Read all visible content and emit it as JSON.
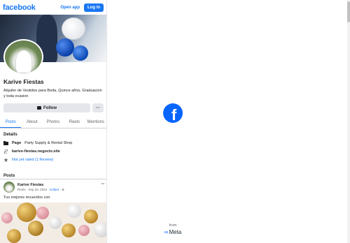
{
  "header": {
    "logo": "facebook",
    "open_app": "Open app",
    "login": "Log in"
  },
  "profile": {
    "name": "Karive Fiestas",
    "bio": "Alquiler de Vestidos para Boda, Quince años, Graduacion y toda ocasion",
    "follow_label": "Follow",
    "more_label": "···"
  },
  "tabs": [
    "Posts",
    "About",
    "Photos",
    "Reels",
    "Mentions"
  ],
  "details": {
    "title": "Details",
    "page_label": "Page",
    "page_category": "Party Supply & Rental Shop",
    "website": "karive-fiestas.negocio.site",
    "rating": "Not yet rated (1 Review)"
  },
  "posts": {
    "title": "Posts",
    "items": [
      {
        "author": "Karive Fiestas",
        "source": "Reels",
        "date": "Sep 20, 2024",
        "edited": "Edited",
        "dots": "···",
        "text": "Tus mejores recuerdos con"
      }
    ]
  },
  "branding": {
    "from": "from",
    "meta": "Meta",
    "center_logo": "f"
  },
  "colors": {
    "brand_blue": "#1877f2",
    "meta_blue": "#0866ff"
  },
  "icons": [
    "chat-icon",
    "page-icon",
    "link-icon",
    "star-icon",
    "globe-icon"
  ]
}
